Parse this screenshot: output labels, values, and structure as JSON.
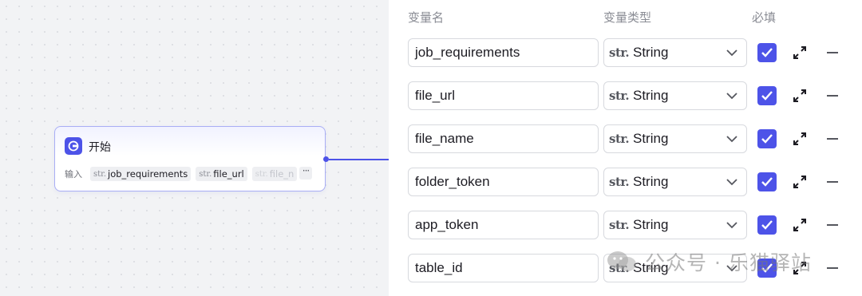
{
  "node": {
    "title": "开始",
    "inputs_label": "输入",
    "inputs": [
      {
        "type_glyph": "str.",
        "name": "job_requirements"
      },
      {
        "type_glyph": "str.",
        "name": "file_url"
      },
      {
        "type_glyph": "str.",
        "name": "file_n"
      }
    ],
    "more": "···"
  },
  "panel": {
    "headers": {
      "name": "变量名",
      "type": "变量类型",
      "required": "必填"
    },
    "rows": [
      {
        "name": "job_requirements",
        "type_glyph": "str.",
        "type": "String",
        "required": true
      },
      {
        "name": "file_url",
        "type_glyph": "str.",
        "type": "String",
        "required": true
      },
      {
        "name": "file_name",
        "type_glyph": "str.",
        "type": "String",
        "required": true
      },
      {
        "name": "folder_token",
        "type_glyph": "str.",
        "type": "String",
        "required": true
      },
      {
        "name": "app_token",
        "type_glyph": "str.",
        "type": "String",
        "required": true
      },
      {
        "name": "table_id",
        "type_glyph": "str.",
        "type": "String",
        "required": true
      }
    ]
  },
  "watermark": {
    "text": "公众号 · 乐猫驿站"
  },
  "colors": {
    "accent": "#4d53e8",
    "border": "#d7d9de",
    "text": "#1d1c23",
    "muted": "#8a8c94"
  }
}
